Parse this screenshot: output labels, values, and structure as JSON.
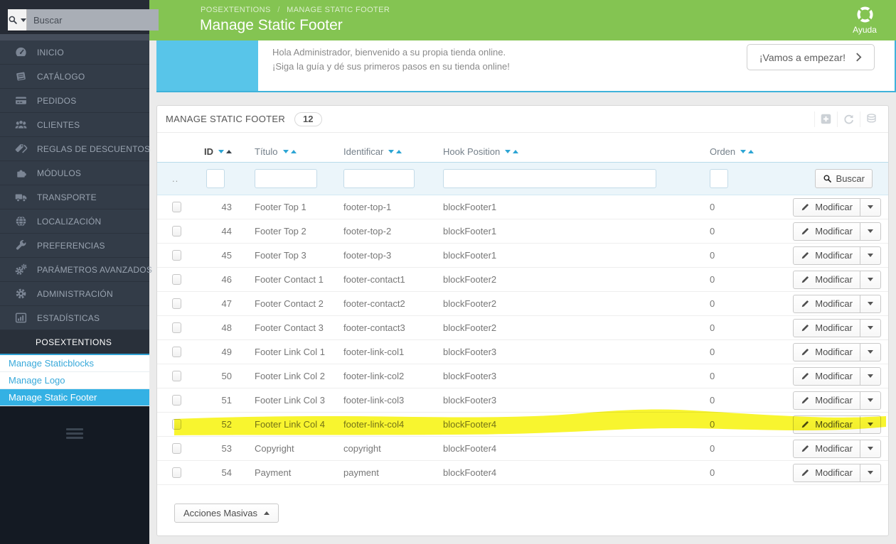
{
  "colors": {
    "header_green": "#84c452",
    "accent_blue": "#34b1e4",
    "teal_panel": "#58c5e9",
    "highlight_yellow": "#f7f301",
    "sidebar_bg": "#333c48"
  },
  "topbar": {
    "search_placeholder": "Buscar"
  },
  "header": {
    "breadcrumb_parent": "POSEXTENTIONS",
    "breadcrumb_sep": "/",
    "breadcrumb_current": "MANAGE STATIC FOOTER",
    "title": "Manage Static Footer",
    "help_label": "Ayuda"
  },
  "sidebar": {
    "items": [
      {
        "label": "INICIO",
        "icon": "gauge-icon"
      },
      {
        "label": "CATÁLOGO",
        "icon": "book-icon"
      },
      {
        "label": "PEDIDOS",
        "icon": "credit-card-icon"
      },
      {
        "label": "CLIENTES",
        "icon": "users-icon"
      },
      {
        "label": "REGLAS DE DESCUENTOS",
        "icon": "tags-icon"
      },
      {
        "label": "MÓDULOS",
        "icon": "puzzle-icon"
      },
      {
        "label": "TRANSPORTE",
        "icon": "truck-icon"
      },
      {
        "label": "LOCALIZACIÓN",
        "icon": "globe-icon"
      },
      {
        "label": "PREFERENCIAS",
        "icon": "wrench-icon"
      },
      {
        "label": "PARÁMETROS AVANZADOS",
        "icon": "gears-icon"
      },
      {
        "label": "ADMINISTRACIÓN",
        "icon": "gear-icon"
      },
      {
        "label": "ESTADÍSTICAS",
        "icon": "chart-icon"
      }
    ],
    "section_label": "POSEXTENTIONS",
    "submenu": [
      {
        "label": "Manage Staticblocks",
        "active": false
      },
      {
        "label": "Manage Logo",
        "active": false
      },
      {
        "label": "Manage Static Footer",
        "active": true
      }
    ]
  },
  "welcome": {
    "line1": "Hola Administrador, bienvenido a su propia tienda online.",
    "line2": "¡Siga la guía y dé sus primeros pasos en su tienda online!",
    "cta_label": "¡Vamos a empezar!"
  },
  "panel": {
    "title": "MANAGE STATIC FOOTER",
    "count": "12"
  },
  "table": {
    "columns": [
      "ID",
      "Título",
      "Identificar",
      "Hook Position",
      "Orden"
    ],
    "filter_dots": "..",
    "search_button": "Buscar",
    "action_button": "Modificar",
    "rows": [
      {
        "id": "43",
        "titulo": "Footer Top 1",
        "identificar": "footer-top-1",
        "hook": "blockFooter1",
        "orden": "0",
        "highlighted": false
      },
      {
        "id": "44",
        "titulo": "Footer Top 2",
        "identificar": "footer-top-2",
        "hook": "blockFooter1",
        "orden": "0",
        "highlighted": false
      },
      {
        "id": "45",
        "titulo": "Footer Top 3",
        "identificar": "footer-top-3",
        "hook": "blockFooter1",
        "orden": "0",
        "highlighted": false
      },
      {
        "id": "46",
        "titulo": "Footer Contact 1",
        "identificar": "footer-contact1",
        "hook": "blockFooter2",
        "orden": "0",
        "highlighted": false
      },
      {
        "id": "47",
        "titulo": "Footer Contact 2",
        "identificar": "footer-contact2",
        "hook": "blockFooter2",
        "orden": "0",
        "highlighted": false
      },
      {
        "id": "48",
        "titulo": "Footer Contact 3",
        "identificar": "footer-contact3",
        "hook": "blockFooter2",
        "orden": "0",
        "highlighted": false
      },
      {
        "id": "49",
        "titulo": "Footer Link Col 1",
        "identificar": "footer-link-col1",
        "hook": "blockFooter3",
        "orden": "0",
        "highlighted": false
      },
      {
        "id": "50",
        "titulo": "Footer Link Col 2",
        "identificar": "footer-link-col2",
        "hook": "blockFooter3",
        "orden": "0",
        "highlighted": false
      },
      {
        "id": "51",
        "titulo": "Footer Link Col 3",
        "identificar": "footer-link-col3",
        "hook": "blockFooter3",
        "orden": "0",
        "highlighted": false
      },
      {
        "id": "52",
        "titulo": "Footer Link Col 4",
        "identificar": "footer-link-col4",
        "hook": "blockFooter4",
        "orden": "0",
        "highlighted": true
      },
      {
        "id": "53",
        "titulo": "Copyright",
        "identificar": "copyright",
        "hook": "blockFooter4",
        "orden": "0",
        "highlighted": false
      },
      {
        "id": "54",
        "titulo": "Payment",
        "identificar": "payment",
        "hook": "blockFooter4",
        "orden": "0",
        "highlighted": false
      }
    ]
  },
  "bulk_actions_label": "Acciones Masivas"
}
